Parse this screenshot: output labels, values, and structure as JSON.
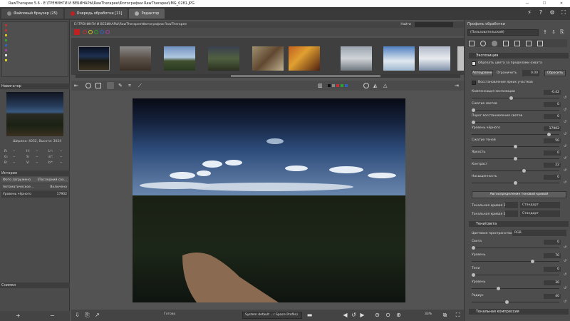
{
  "window": {
    "title": "RawTherapee 5.6 - E:\\ТРЕНИНГИ И ВЕБИНАРЫ\\RawTherapee\\Фотографии RawTherapee\\IMG_0281.JPG",
    "minimize": "—",
    "maximize": "☐",
    "close": "✕"
  },
  "tabs": [
    {
      "label": "Файловый браузер (25)"
    },
    {
      "label": "Очередь обработки [11]"
    },
    {
      "label": "Редактор"
    }
  ],
  "top_icons": [
    "⚡",
    "?",
    "⚙",
    "⛶"
  ],
  "path_bar": {
    "path": "E:\\ТРЕНИНГИ И ВЕБИНАРЫ\\RawTherapee\\Фотографии RawTherapee",
    "find_label": "Найти"
  },
  "left": {
    "navigator_title": "Навигатор",
    "image_size": "Ширина: 4032, Высота: 3024",
    "color_readout": {
      "r": "R:",
      "r_val": "--",
      "g": "G:",
      "g_val": "--",
      "b": "B:",
      "b_val": "--",
      "h": "H:",
      "s": "S:",
      "v": "V:",
      "l": "L*:",
      "a": "a*:",
      "bb": "b*:",
      "dash": "--"
    },
    "history_title": "История",
    "history": [
      {
        "k": "Фото загружено",
        "v": "(Последний сох..."
      },
      {
        "k": "Автоматическое...",
        "v": "Включено"
      },
      {
        "k": "Уровень чёрного",
        "v": "17902"
      }
    ],
    "snapshots_title": "Снимки",
    "add": "+",
    "remove": "−"
  },
  "bottom_bar": {
    "ready": "Готово",
    "profile": "System default ...r Space Profile)",
    "zoom": "33%"
  },
  "right": {
    "profile_title": "Профиль обработки",
    "profile_value": "(Пользовательский)",
    "exposure_title": "Экспозиция",
    "clip_label": "Обрезать цвета за пределами охвата",
    "auto_label": "Автоуровни",
    "limit_label": "Ограничить",
    "limit_value": "0.00",
    "reset_label": "Сбросить",
    "highlight_recovery": "Восстановление ярких участков",
    "sliders": [
      {
        "label": "Компенсация экспозиции",
        "value": "-0.42",
        "pos": 0.45
      },
      {
        "label": "Сжатие светов",
        "value": "0",
        "pos": 0.0
      },
      {
        "label": "Порог восстановления светов",
        "value": "0",
        "pos": 0.0
      },
      {
        "label": "Уровень чёрного",
        "value": "17902",
        "pos": 0.9
      },
      {
        "label": "Сжатие теней",
        "value": "50",
        "pos": 0.5
      },
      {
        "label": "Яркость",
        "value": "0",
        "pos": 0.5
      },
      {
        "label": "Контраст",
        "value": "22",
        "pos": 0.6
      },
      {
        "label": "Насыщенность",
        "value": "0",
        "pos": 0.5
      }
    ],
    "auto_tone_curve": "Автоопределение тоновой кривой",
    "tone_curve_1": "Тональная кривая 1",
    "tone_curve_2": "Тональная кривая 2",
    "standard": "Стандарт",
    "shadows_title": "Тени/света",
    "color_space_label": "Цветовое пространство",
    "color_space_value": "RGB",
    "sliders2": [
      {
        "label": "Света",
        "value": "0",
        "pos": 0.0
      },
      {
        "label": "Уровень",
        "value": "70",
        "pos": 0.7
      },
      {
        "label": "Тени",
        "value": "0",
        "pos": 0.0
      },
      {
        "label": "Уровень",
        "value": "30",
        "pos": 0.3
      },
      {
        "label": "Радиус",
        "value": "40",
        "pos": 0.4
      }
    ],
    "tone_compress_title": "Тональная компрессия"
  },
  "colors": {
    "accent_red": "#c02020",
    "panel": "#4d4d4d",
    "dark": "#3b3b3b"
  }
}
